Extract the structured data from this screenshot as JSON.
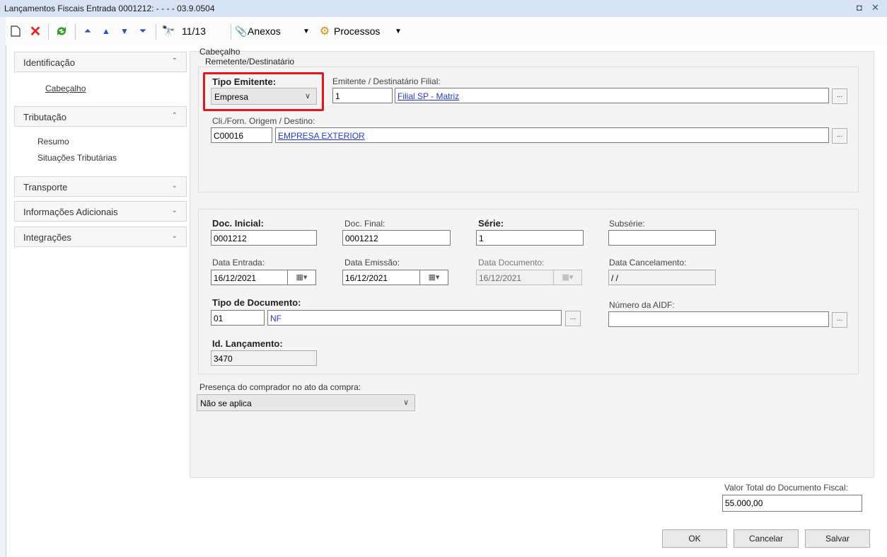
{
  "window": {
    "title": "Lançamentos Fiscais Entrada 0001212: - - - - 03.9.0504",
    "restore_glyph": "◘",
    "close_glyph": "✕"
  },
  "toolbar": {
    "record_counter": "11/13",
    "anexos_label": "Anexos",
    "processos_label": "Processos"
  },
  "sidebar": {
    "sections": [
      {
        "label": "Identificação",
        "expanded": true,
        "items": [
          "Cabeçalho"
        ]
      },
      {
        "label": "Tributação",
        "expanded": true,
        "items": [
          "Resumo",
          "Situações Tributárias"
        ]
      },
      {
        "label": "Transporte",
        "expanded": false
      },
      {
        "label": "Informações Adicionais",
        "expanded": false
      },
      {
        "label": "Integrações",
        "expanded": false
      }
    ]
  },
  "header_group": {
    "title": "Cabeçalho",
    "subgroup_title": "Remetente/Destinatário",
    "tipo_emitente": {
      "label": "Tipo Emitente:",
      "value": "Empresa"
    },
    "emitente_filial": {
      "label": "Emitente / Destinatário Filial:",
      "code": "1",
      "name": "Filial SP - Matriz"
    },
    "cli_forn": {
      "label": "Cli./Forn. Origem / Destino:",
      "code": "C00016",
      "name": "EMPRESA EXTERIOR"
    }
  },
  "document_group": {
    "doc_inicial": {
      "label": "Doc. Inicial:",
      "value": "0001212"
    },
    "doc_final": {
      "label": "Doc. Final:",
      "value": "0001212"
    },
    "serie": {
      "label": "Série:",
      "value": "1"
    },
    "subserie": {
      "label": "Subsérie:",
      "value": ""
    },
    "data_entrada": {
      "label": "Data Entrada:",
      "value": "16/12/2021"
    },
    "data_emissao": {
      "label": "Data Emissão:",
      "value": "16/12/2021"
    },
    "data_documento": {
      "label": "Data Documento:",
      "value": "16/12/2021"
    },
    "data_cancelamento": {
      "label": "Data Cancelamento:",
      "value": " / /"
    },
    "tipo_documento": {
      "label": "Tipo de Documento:",
      "code": "01",
      "name": "NF"
    },
    "numero_aidf": {
      "label": "Número da AIDF:",
      "value": ""
    },
    "id_lancamento": {
      "label": "Id. Lançamento:",
      "value": "3470"
    }
  },
  "presenca": {
    "label": "Presença do comprador no ato da compra:",
    "value": "Não se aplica"
  },
  "total": {
    "label": "Valor Total do Documento Fiscal:",
    "value": "55.000,00"
  },
  "buttons": {
    "ok": "OK",
    "cancelar": "Cancelar",
    "salvar": "Salvar",
    "ellipsis": "..."
  },
  "icons": {
    "new": "new-document-icon",
    "delete": "delete-icon",
    "refresh": "refresh-icon",
    "first": "first-record-icon",
    "prev": "previous-record-icon",
    "next": "next-record-icon",
    "last": "last-record-icon",
    "find": "binoculars-icon",
    "attach": "paperclip-icon",
    "process": "gears-icon"
  },
  "colors": {
    "highlight": "#e3181f",
    "link": "#1f3bc9",
    "titlebar": "#d7e3f3"
  }
}
